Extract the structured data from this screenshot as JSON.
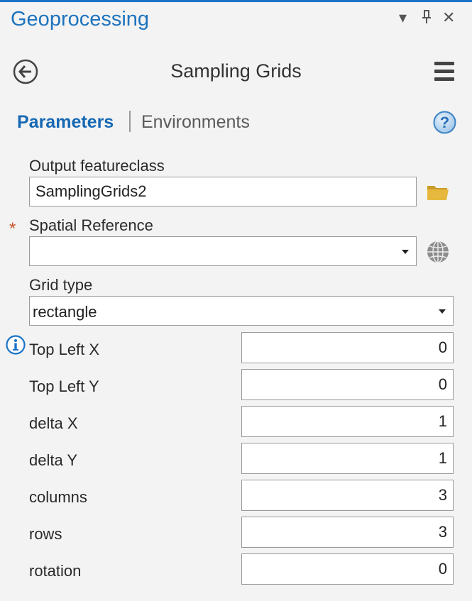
{
  "pane": {
    "title": "Geoprocessing",
    "controls": {
      "dropdown": "▾",
      "pin": "⊥",
      "close": "✕"
    }
  },
  "tool": {
    "title": "Sampling Grids",
    "back_icon": "back-arrow-icon",
    "menu_icon": "hamburger-menu-icon"
  },
  "tabs": {
    "active": "Parameters",
    "inactive": "Environments",
    "help_icon": "help-icon"
  },
  "params": {
    "output_featureclass": {
      "label": "Output featureclass",
      "value": "SamplingGrids2"
    },
    "spatial_reference": {
      "label": "Spatial Reference",
      "value": "",
      "required_mark": "*"
    },
    "grid_type": {
      "label": "Grid type",
      "value": "rectangle"
    },
    "top_left_x": {
      "label": "Top Left X",
      "value": "0"
    },
    "top_left_y": {
      "label": "Top Left Y",
      "value": "0"
    },
    "delta_x": {
      "label": "delta X",
      "value": "1"
    },
    "delta_y": {
      "label": "delta Y",
      "value": "1"
    },
    "columns": {
      "label": "columns",
      "value": "3"
    },
    "rows": {
      "label": "rows",
      "value": "3"
    },
    "rotation": {
      "label": "rotation",
      "value": "0"
    }
  },
  "colors": {
    "accent": "#1e73be",
    "folder": "#e0b33a",
    "required": "#c8562b",
    "info": "#1a73c7"
  }
}
